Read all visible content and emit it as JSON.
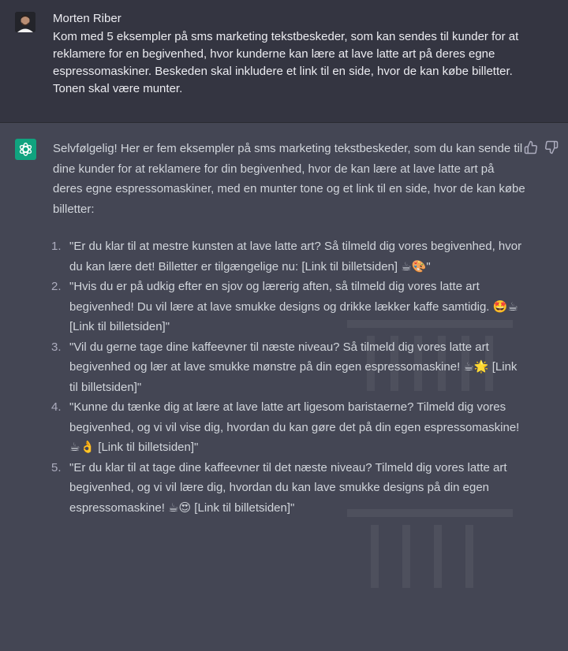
{
  "user": {
    "name": "Morten Riber",
    "message": "Kom med 5 eksempler på sms marketing tekstbeskeder, som kan sendes til kunder for at reklamere for en begivenhed, hvor kunderne kan lære at lave latte art på deres egne espressomaskiner. Beskeden skal inkludere et link til en side, hvor de kan købe billetter. Tonen skal være munter."
  },
  "assistant": {
    "intro": "Selvfølgelig! Her er fem eksempler på sms marketing tekstbeskeder, som du kan sende til dine kunder for at reklamere for din begivenhed, hvor de kan lære at lave latte art på deres egne espressomaskiner, med en munter tone og et link til en side, hvor de kan købe billetter:",
    "items": [
      {
        "num": "1.",
        "text": "\"Er du klar til at mestre kunsten at lave latte art? Så tilmeld dig vores begivenhed, hvor du kan lære det! Billetter er tilgængelige nu: [Link til billetsiden] ☕🎨\""
      },
      {
        "num": "2.",
        "text": "\"Hvis du er på udkig efter en sjov og lærerig aften, så tilmeld dig vores latte art begivenhed! Du vil lære at lave smukke designs og drikke lækker kaffe samtidig. 🤩☕ [Link til billetsiden]\""
      },
      {
        "num": "3.",
        "text": "\"Vil du gerne tage dine kaffeevner til næste niveau? Så tilmeld dig vores latte art begivenhed og lær at lave smukke mønstre på din egen espressomaskine! ☕🌟 [Link til billetsiden]\""
      },
      {
        "num": "4.",
        "text": "\"Kunne du tænke dig at lære at lave latte art ligesom baristaerne? Tilmeld dig vores begivenhed, og vi vil vise dig, hvordan du kan gøre det på din egen espressomaskine! ☕👌 [Link til billetsiden]\""
      },
      {
        "num": "5.",
        "text": "\"Er du klar til at tage dine kaffeevner til det næste niveau? Tilmeld dig vores latte art begivenhed, og vi vil lære dig, hvordan du kan lave smukke designs på din egen espressomaskine! ☕😍 [Link til billetsiden]\""
      }
    ]
  },
  "icons": {
    "avatar": "user-avatar",
    "assistant": "openai-logo-icon",
    "feedback_up": "thumbs-up-icon",
    "feedback_down": "thumbs-down-icon"
  },
  "colors": {
    "user_bg": "#343541",
    "assistant_bg": "#444654",
    "brand": "#10a37f"
  }
}
